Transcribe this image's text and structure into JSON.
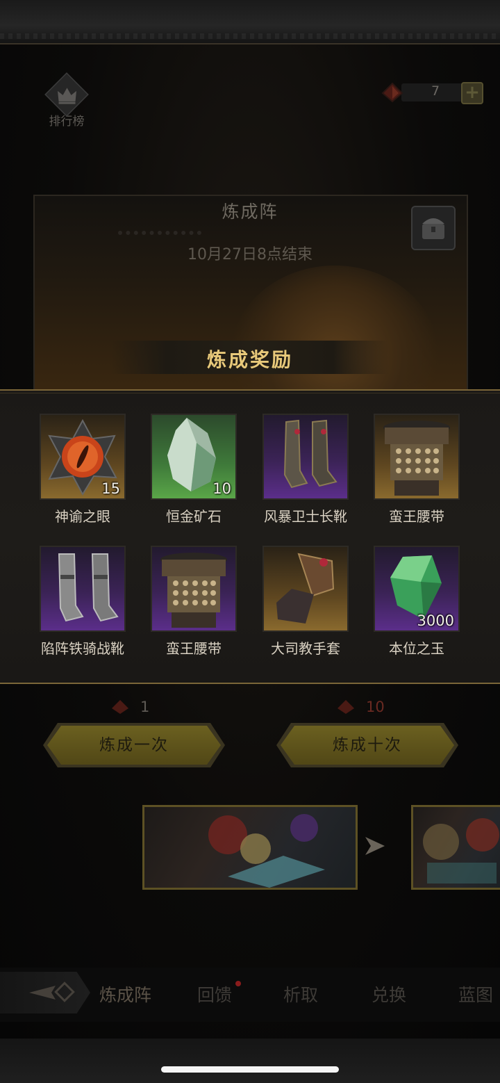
{
  "header": {
    "ranking_label": "排行榜",
    "currency_value": "7",
    "plus_label": "+"
  },
  "banner": {
    "title": "炼成阵",
    "end_time": "10月27日8点结束"
  },
  "rewards": {
    "title": "炼成奖励",
    "items": [
      {
        "name": "神谕之眼",
        "qty": "15",
        "rarity": "gold"
      },
      {
        "name": "恒金矿石",
        "qty": "10",
        "rarity": "green"
      },
      {
        "name": "风暴卫士长靴",
        "qty": "",
        "rarity": "purple"
      },
      {
        "name": "蛮王腰带",
        "qty": "",
        "rarity": "gold"
      },
      {
        "name": "陷阵铁骑战靴",
        "qty": "",
        "rarity": "purple"
      },
      {
        "name": "蛮王腰带",
        "qty": "",
        "rarity": "purple"
      },
      {
        "name": "大司教手套",
        "qty": "",
        "rarity": "gold"
      },
      {
        "name": "本位之玉",
        "qty": "3000",
        "rarity": "purple"
      }
    ]
  },
  "actions": {
    "cost_once": "1",
    "cost_ten": "10",
    "once_label": "炼成一次",
    "ten_label": "炼成十次"
  },
  "tabs": [
    "炼成阵",
    "回馈",
    "析取",
    "兑换",
    "蓝图"
  ],
  "colors": {
    "accent_gold": "#e8c97a",
    "button_gold": "#6b6020",
    "notification_red": "#8a1c1c"
  }
}
